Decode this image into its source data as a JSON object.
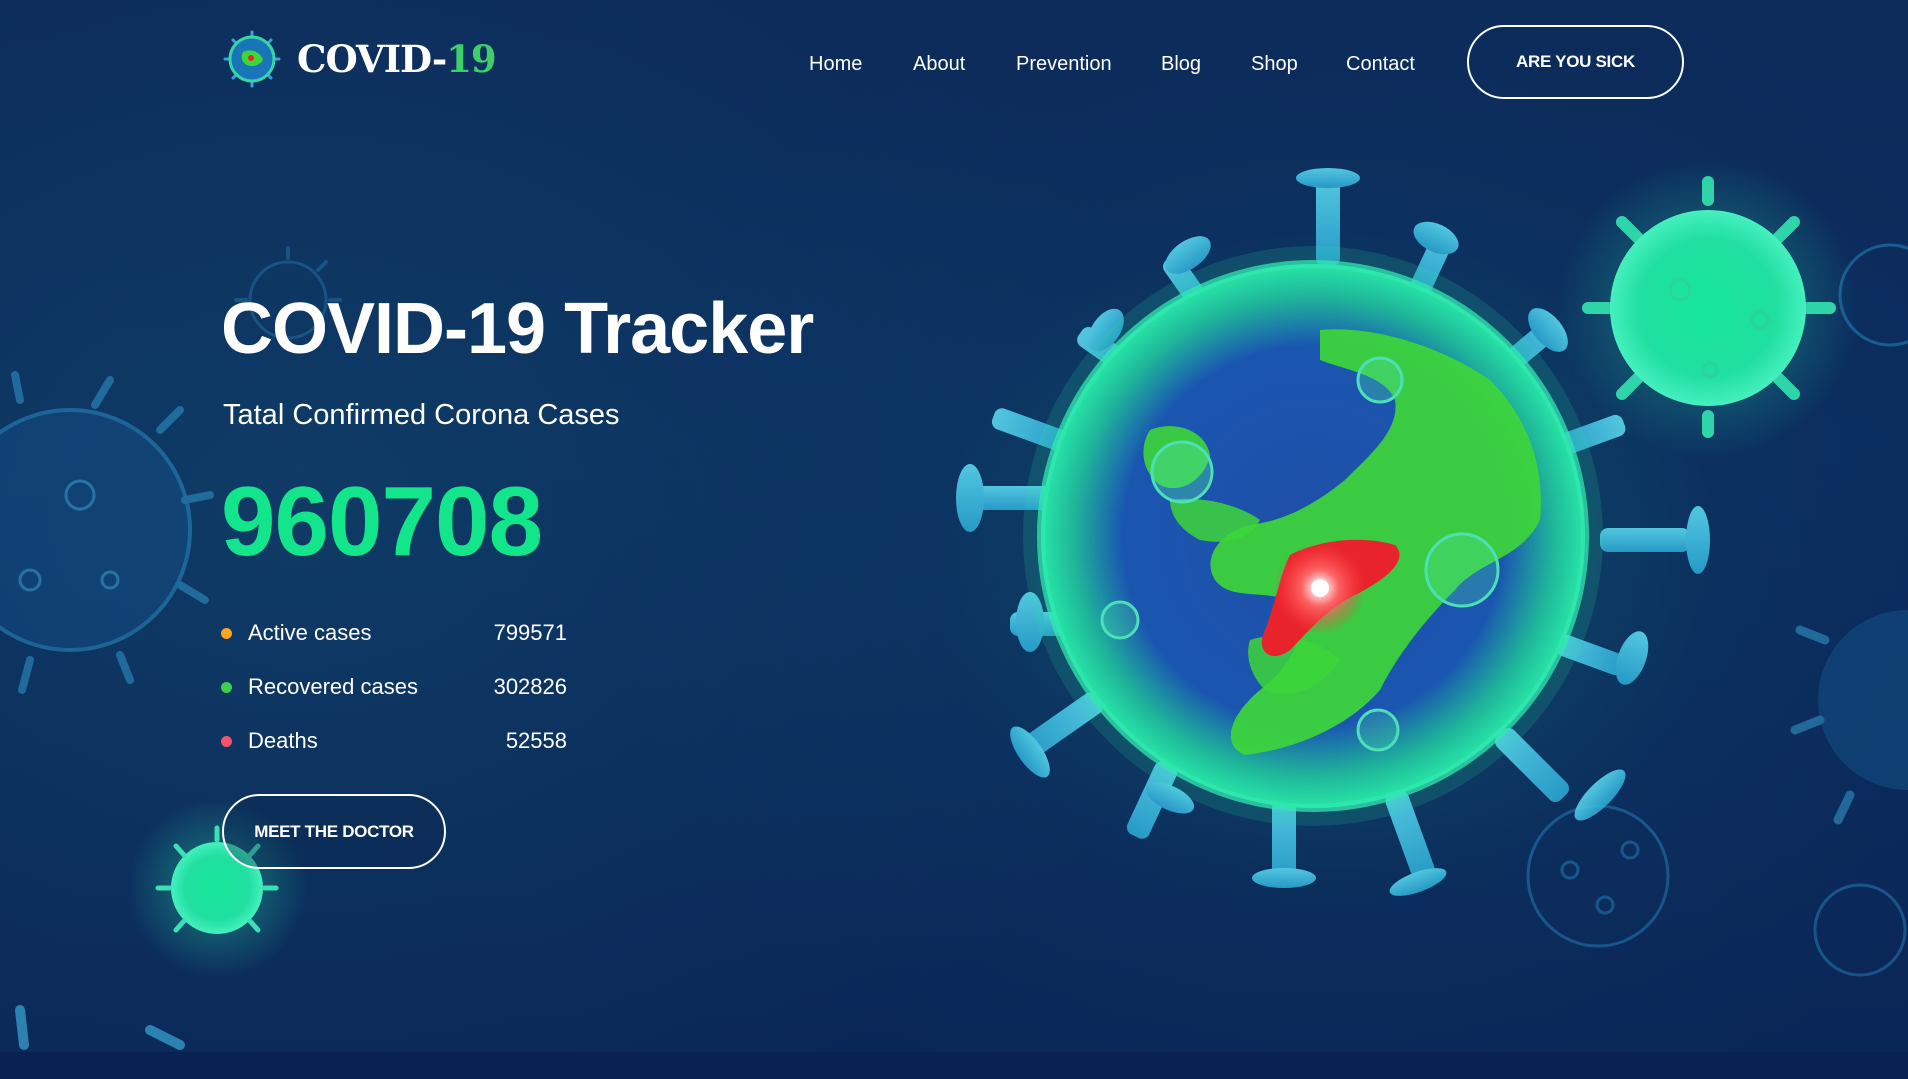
{
  "brand": {
    "name_main": "COVID",
    "name_dash": "-",
    "name_num": "19"
  },
  "nav": {
    "items": [
      {
        "label": "Home"
      },
      {
        "label": "About"
      },
      {
        "label": "Prevention"
      },
      {
        "label": "Blog"
      },
      {
        "label": "Shop"
      },
      {
        "label": "Contact"
      }
    ],
    "cta_label": "ARE YOU SICK"
  },
  "hero": {
    "title": "COVID-19 Tracker",
    "subtitle": "Tatal Confirmed Corona Cases",
    "total_count": "960708",
    "stats": [
      {
        "label": "Active cases",
        "value": "799571",
        "dot_color": "#f5a623"
      },
      {
        "label": "Recovered cases",
        "value": "302826",
        "dot_color": "#3fcf4e"
      },
      {
        "label": "Deaths",
        "value": "52558",
        "dot_color": "#f0566a"
      }
    ],
    "cta_label": "MEET THE DOCTOR"
  },
  "colors": {
    "background": "#0b2c5e",
    "accent_green": "#13e58a",
    "logo_number_green": "#3fcf6a",
    "hotspot_red": "#e8232c"
  },
  "illustration": {
    "subject": "virus-globe",
    "decorations": [
      "virus-particle-icon"
    ]
  }
}
